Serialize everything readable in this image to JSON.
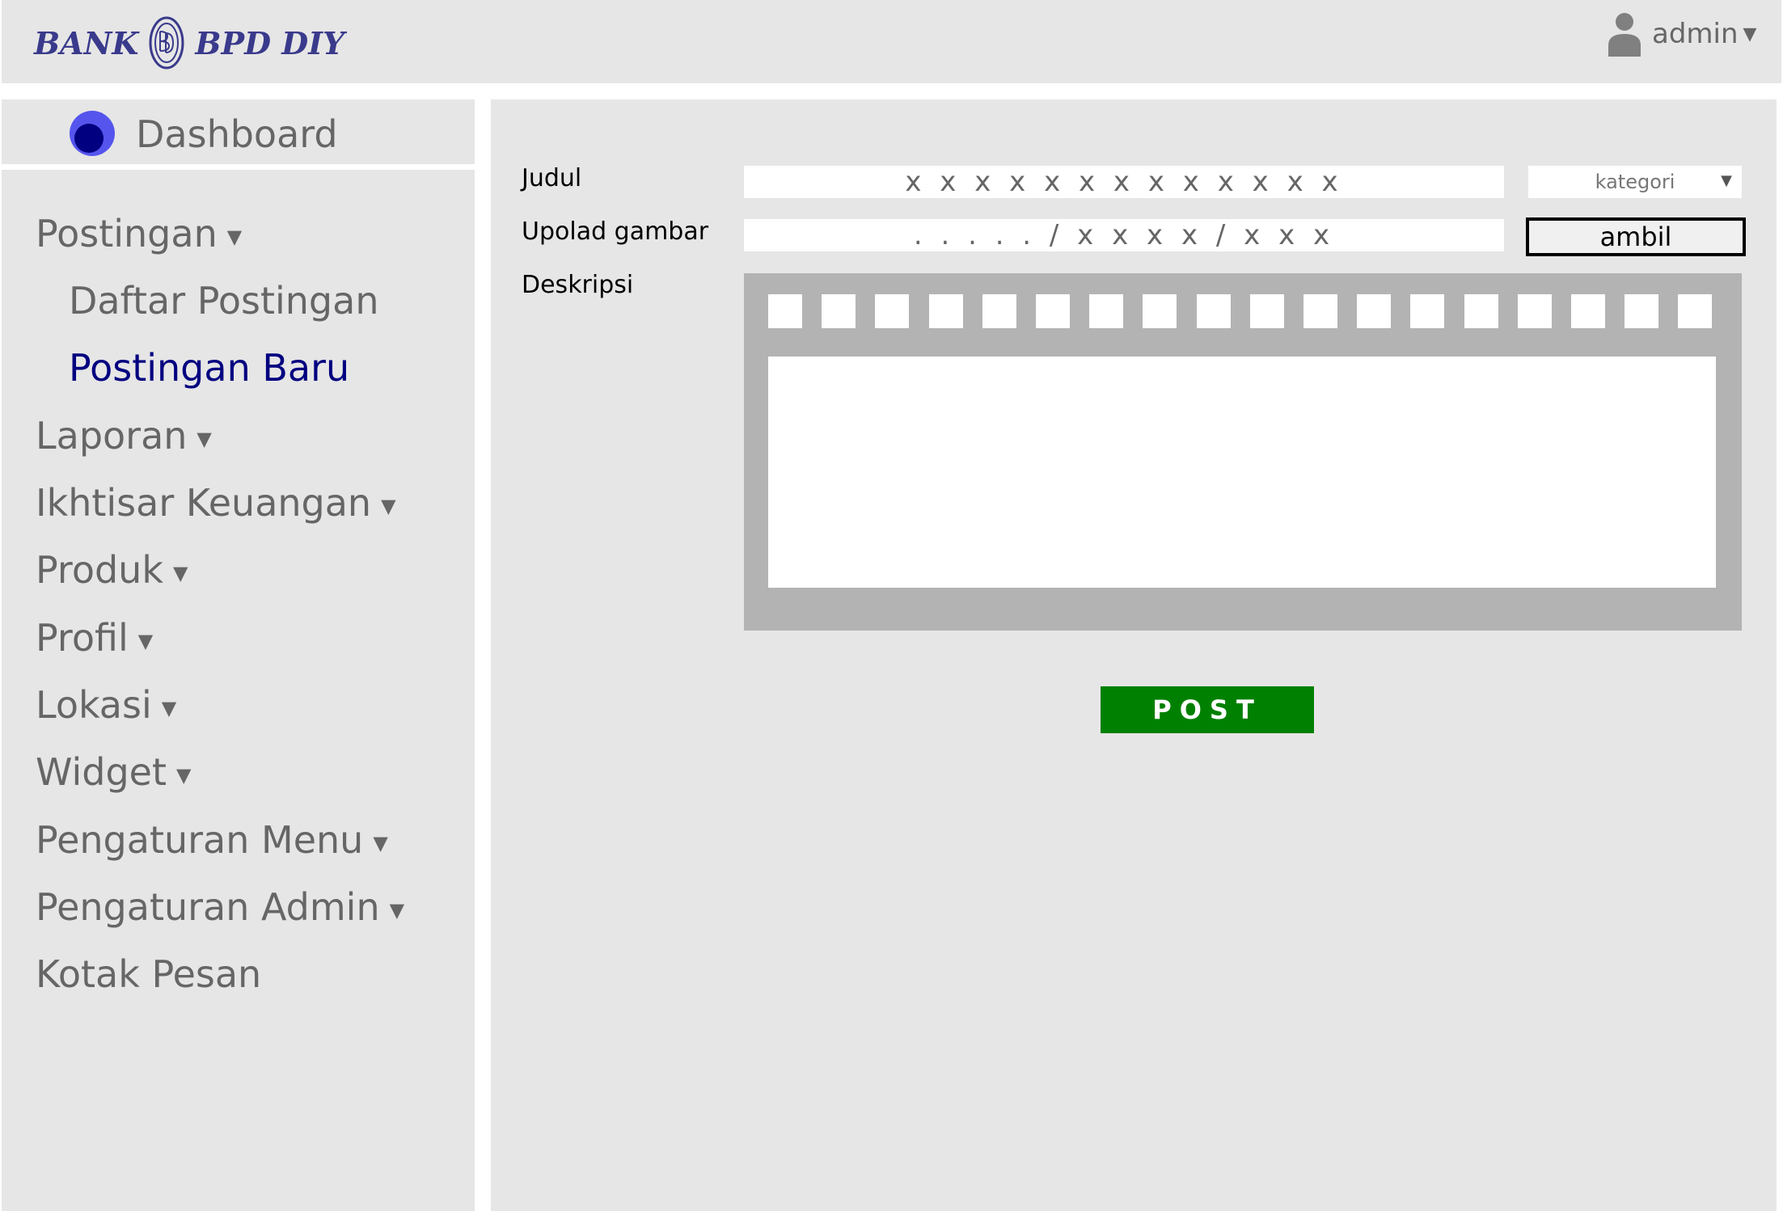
{
  "header": {
    "brand_left": "BANK",
    "brand_right": "BPD DIY",
    "user_label": "admin"
  },
  "sidebar": {
    "dashboard_label": "Dashboard",
    "items": [
      {
        "label": "Postingan",
        "has_caret": true
      },
      {
        "label": "Daftar Postingan",
        "sub": true
      },
      {
        "label": "Postingan Baru",
        "sub": true,
        "active": true
      },
      {
        "label": "Laporan",
        "has_caret": true
      },
      {
        "label": "Ikhtisar Keuangan",
        "has_caret": true
      },
      {
        "label": "Produk",
        "has_caret": true
      },
      {
        "label": "Profil",
        "has_caret": true
      },
      {
        "label": "Lokasi",
        "has_caret": true
      },
      {
        "label": "Widget",
        "has_caret": true
      },
      {
        "label": "Pengaturan Menu",
        "has_caret": true
      },
      {
        "label": "Pengaturan Admin",
        "has_caret": true
      },
      {
        "label": "Kotak Pesan"
      }
    ]
  },
  "form": {
    "title_label": "Judul",
    "title_value": "x x x x x x x x x x x x x",
    "category_select": "kategori",
    "upload_label": "Upolad gambar",
    "upload_value": ". . . . .  / x x x x / x x x",
    "ambil_button": "ambil",
    "description_label": "Deskripsi",
    "toolbar_button_count": 18,
    "post_button": "POST"
  },
  "colors": {
    "panel_bg": "#e6e6e6",
    "active_link": "#000080",
    "post_button": "#008000",
    "brand": "#3a3a8c",
    "dashboard_icon": "#5555ee"
  }
}
